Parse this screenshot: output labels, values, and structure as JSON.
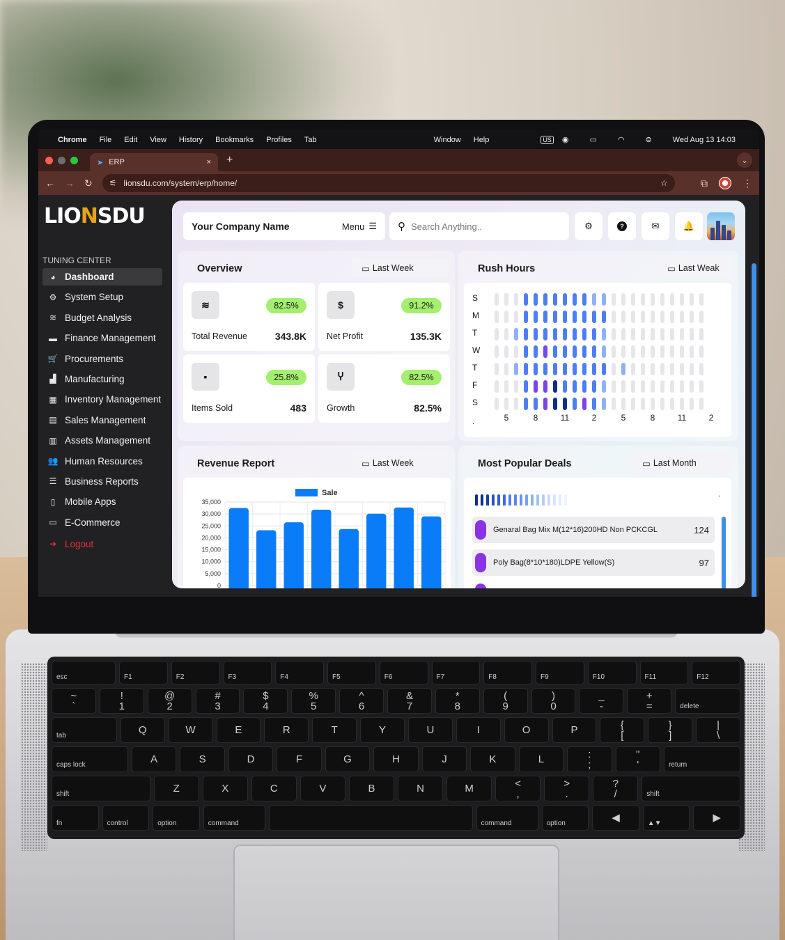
{
  "os_menubar": {
    "apple": "",
    "app": "Chrome",
    "items": [
      "File",
      "Edit",
      "View",
      "History",
      "Bookmarks",
      "Profiles",
      "Tab",
      "Window",
      "Help"
    ],
    "input_source": "US",
    "datetime": "Wed Aug 13  14:03"
  },
  "browser": {
    "tab_title": "ERP",
    "url": "lionsdu.com/system/erp/home/",
    "new_tab": "+",
    "close": "×",
    "back": "←",
    "forward": "→",
    "reload": "↻"
  },
  "sidebar": {
    "logo": {
      "left": "LIO",
      "mark": "N",
      "right": "SDU"
    },
    "section": "TUNING CENTER",
    "items": [
      {
        "label": "Dashboard",
        "icon": "pie-chart-icon",
        "glyph": "◕",
        "active": true
      },
      {
        "label": "System Setup",
        "icon": "gears-icon",
        "glyph": "⚙"
      },
      {
        "label": "Budget Analysis",
        "icon": "coins-icon",
        "glyph": "≋"
      },
      {
        "label": "Finance Management",
        "icon": "wallet-icon",
        "glyph": "▬"
      },
      {
        "label": "Procurements",
        "icon": "cart-icon",
        "glyph": "🛒"
      },
      {
        "label": "Manufacturing",
        "icon": "industry-icon",
        "glyph": "▟"
      },
      {
        "label": "Inventory Management",
        "icon": "boxes-icon",
        "glyph": "▦"
      },
      {
        "label": "Sales Management",
        "icon": "cash-register-icon",
        "glyph": "▤"
      },
      {
        "label": "Assets Management",
        "icon": "building-icon",
        "glyph": "▥"
      },
      {
        "label": "Human Resources",
        "icon": "users-icon",
        "glyph": "👥"
      },
      {
        "label": "Business Reports",
        "icon": "chart-icon",
        "glyph": "☰"
      },
      {
        "label": "Mobile Apps",
        "icon": "mobile-icon",
        "glyph": "▯"
      },
      {
        "label": "E-Commerce",
        "icon": "shop-icon",
        "glyph": "▭"
      }
    ],
    "logout": "Logout"
  },
  "topbar": {
    "company": "Your Company Name",
    "menu": "Menu",
    "search_placeholder": "Search Anything.."
  },
  "overview": {
    "title": "Overview",
    "period": "Last Week",
    "cards": [
      {
        "label": "Total Revenue",
        "value": "343.8K",
        "badge": "82.5%",
        "icon": "coins-icon",
        "glyph": "≋"
      },
      {
        "label": "Net Profit",
        "value": "135.3K",
        "badge": "91.2%",
        "icon": "dollar-icon",
        "glyph": "$"
      },
      {
        "label": "Items Sold",
        "value": "483",
        "badge": "25.8%",
        "icon": "bag-icon",
        "glyph": "▪"
      },
      {
        "label": "Growth",
        "value": "82.5%",
        "badge": "82.5%",
        "icon": "seedling-icon",
        "glyph": "Ⴤ"
      }
    ]
  },
  "rush_hours": {
    "title": "Rush Hours",
    "period": "Last Weak",
    "days": [
      "S",
      "M",
      "T",
      "W",
      "T",
      "F",
      "S"
    ],
    "hours": [
      "5",
      "8",
      "11",
      "2",
      "5",
      "8",
      "11",
      "2"
    ],
    "extra_mark": "."
  },
  "revenue_report": {
    "title": "Revenue Report",
    "period": "Last Week"
  },
  "popular_deals": {
    "title": "Most Popular Deals",
    "period": "Last Month",
    "corner_mark": ".",
    "deals": [
      {
        "name": "Genaral Bag Mix M(12*16)200HD Non PCKCGL",
        "count": "124"
      },
      {
        "name": "Poly Bag(8*10*180)LDPE Yellow(S)",
        "count": "97"
      }
    ]
  },
  "chart_data": {
    "type": "bar",
    "series": [
      {
        "name": "Sale",
        "values": [
          32500,
          23200,
          26500,
          31800,
          23700,
          30100,
          32700,
          29000
        ]
      }
    ],
    "yticks": [
      "35,000",
      "30,000",
      "25,000",
      "20,000",
      "15,000",
      "10,000",
      "5,000",
      "0"
    ],
    "ylim": [
      0,
      35000
    ],
    "grid": true,
    "legend": "top-center",
    "color": "#0a7cf7"
  },
  "keyboard": {
    "fn": [
      "esc",
      "F1",
      "F2",
      "F3",
      "F4",
      "F5",
      "F6",
      "F7",
      "F8",
      "F9",
      "F10",
      "F11",
      "F12"
    ],
    "num": [
      "~\n`",
      "!\n1",
      "@\n2",
      "#\n3",
      "$\n4",
      "%\n5",
      "^\n6",
      "&\n7",
      "*\n8",
      "(\n9",
      ")\n0",
      "_\n-",
      "+\n=",
      "delete"
    ],
    "top": [
      "tab",
      "Q",
      "W",
      "E",
      "R",
      "T",
      "Y",
      "U",
      "I",
      "O",
      "P",
      "{\n[",
      "}\n]",
      "|\n\\"
    ],
    "home": [
      "caps lock",
      "A",
      "S",
      "D",
      "F",
      "G",
      "H",
      "J",
      "K",
      "L",
      ":\n;",
      "\"\n'",
      "return"
    ],
    "bottom": [
      "shift",
      "Z",
      "X",
      "C",
      "V",
      "B",
      "N",
      "M",
      "<\n,",
      ">\n.",
      "?\n/",
      "shift"
    ],
    "mods": [
      "fn",
      "control",
      "option",
      "command",
      "",
      "command",
      "option",
      "◀",
      "▲▼",
      "▶"
    ]
  }
}
